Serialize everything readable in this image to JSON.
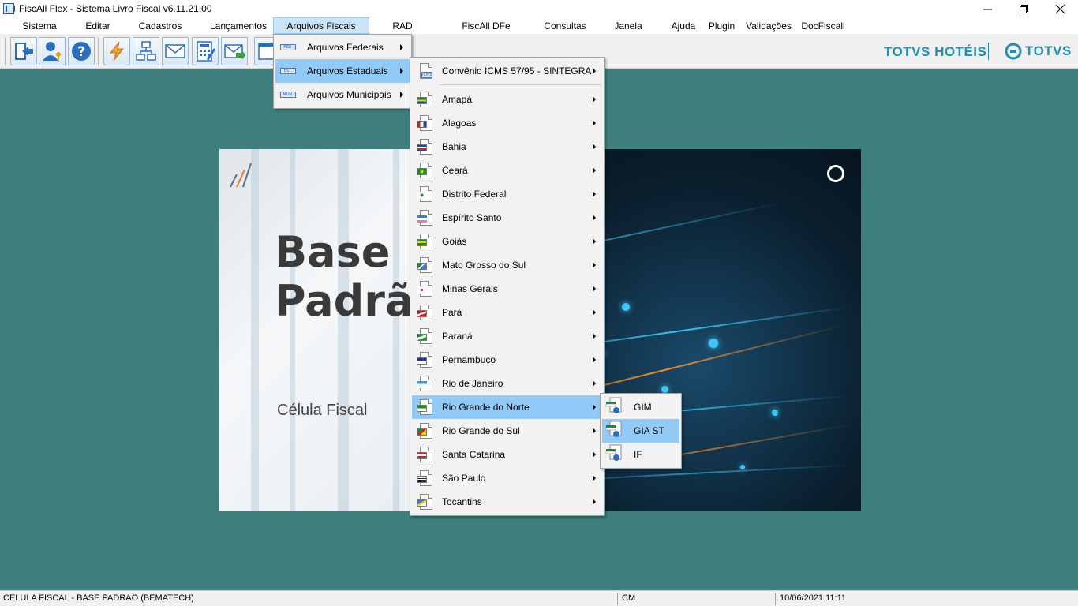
{
  "window": {
    "title": "FiscAll Flex - Sistema Livro Fiscal v6.11.21.00",
    "minimize_icon": "minimize-icon",
    "restore_icon": "restore-icon",
    "close_icon": "close-icon"
  },
  "menubar": {
    "items": [
      {
        "label": "Sistema"
      },
      {
        "label": "Editar"
      },
      {
        "label": "Cadastros"
      },
      {
        "label": "Lançamentos"
      },
      {
        "label": "Arquivos Fiscais"
      },
      {
        "label": "RAD"
      },
      {
        "label": "FiscAll DFe"
      },
      {
        "label": "Consultas"
      },
      {
        "label": "Janela"
      },
      {
        "label": "Ajuda"
      },
      {
        "label": "Plugin"
      },
      {
        "label": "Validações"
      },
      {
        "label": "DocFiscall"
      }
    ]
  },
  "toolbar": {
    "buttons": [
      "exit-icon",
      "user-key-icon",
      "help-icon",
      "lightning-icon",
      "network-icon",
      "mail-icon",
      "calculator-icon",
      "mail-send-icon"
    ]
  },
  "branding": {
    "hoteis": "TOTVS HOTÉIS",
    "totvs": "TOTVS"
  },
  "banner": {
    "title_line1": "Base",
    "title_line2": "Padrã",
    "subtitle": "Célula Fiscal"
  },
  "menu_arquivos_fiscais": {
    "items": [
      {
        "label": "Arquivos Federais",
        "tag": "FED."
      },
      {
        "label": "Arquivos Estaduais",
        "tag": "EST."
      },
      {
        "label": "Arquivos Municipais",
        "tag": "MUN."
      }
    ]
  },
  "menu_estaduais": {
    "header": {
      "label": "Convênio ICMS 57/95 - SINTEGRA",
      "tag": "ICMS"
    },
    "states": [
      {
        "label": "Amapá"
      },
      {
        "label": "Alagoas"
      },
      {
        "label": "Bahia"
      },
      {
        "label": "Ceará"
      },
      {
        "label": "Distrito Federal"
      },
      {
        "label": "Espírito Santo"
      },
      {
        "label": "Goiás"
      },
      {
        "label": "Mato Grosso do Sul"
      },
      {
        "label": "Minas Gerais"
      },
      {
        "label": "Pará"
      },
      {
        "label": "Paraná"
      },
      {
        "label": "Pernambuco"
      },
      {
        "label": "Rio de Janeiro"
      },
      {
        "label": "Rio Grande do Norte"
      },
      {
        "label": "Rio Grande do Sul"
      },
      {
        "label": "Santa Catarina"
      },
      {
        "label": "São Paulo"
      },
      {
        "label": "Tocantins"
      }
    ]
  },
  "menu_rn": {
    "items": [
      {
        "label": "GIM"
      },
      {
        "label": "GIA ST"
      },
      {
        "label": "IF"
      }
    ]
  },
  "statusbar": {
    "company": "CELULA FISCAL - BASE PADRAO (BEMATECH)",
    "mode": "CM",
    "datetime": "10/06/2021 11:11"
  },
  "colors": {
    "workspace": "#3e7e7d",
    "menu_highlight": "#91c9f7",
    "brand": "#1f8fb3"
  }
}
